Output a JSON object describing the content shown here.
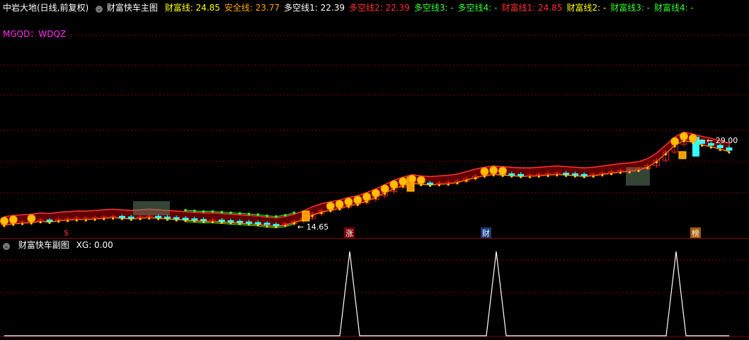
{
  "main_header": {
    "security_name": "中岩大地(日线,前复权)",
    "indicator_title": "财富快车主图",
    "items": [
      {
        "label": "财富线: 24.85",
        "color": "#ffff00"
      },
      {
        "label": "安全线: 23.77",
        "color": "#ffa500"
      },
      {
        "label": "多空线1: 22.39",
        "color": "#ffffff"
      },
      {
        "label": "多空线2: 22.39",
        "color": "#ff3030"
      },
      {
        "label": "多空线3: -",
        "color": "#33ff33"
      },
      {
        "label": "多空线4: -",
        "color": "#33ff33"
      },
      {
        "label": "财富线1: 24.85",
        "color": "#ff3030"
      },
      {
        "label": "财富线2: -",
        "color": "#ffff00"
      },
      {
        "label": "财富线3: -",
        "color": "#33ff33"
      },
      {
        "label": "财富线4: -",
        "color": "#33ff33"
      }
    ],
    "subtitle": "MGQD：WDQZ"
  },
  "annotations": {
    "high_label": "29.00",
    "low_label": "14.65",
    "signal_1": "$",
    "signal_2": "涨",
    "signal_3": "财",
    "signal_4": "榜"
  },
  "sub_header": {
    "indicator_title": "财富快车副图",
    "value_text": "XG: 0.00"
  },
  "icons": {
    "collapse": "chevron-down-icon"
  },
  "colors": {
    "background": "#000000",
    "grid": "#8b0000",
    "up_candle": "#ff2020",
    "down_candle": "#33ffff",
    "band_fill": "#b00000",
    "band_edge": "#ff3030",
    "green_line": "#33ff33",
    "coin": "#ffc000",
    "signal_line": "#ffffff"
  },
  "chart_data": [
    {
      "type": "candlestick",
      "title": "财富快车主图",
      "annotated_high": 29.0,
      "annotated_low": 14.65,
      "close_approx": [
        14.9,
        15.1,
        15.2,
        15.3,
        15.5,
        15.4,
        15.6,
        15.7,
        15.8,
        15.8,
        15.9,
        16.0,
        16.1,
        16.0,
        15.9,
        16.0,
        16.1,
        16.0,
        15.9,
        15.8,
        15.7,
        15.6,
        15.5,
        15.5,
        15.4,
        15.3,
        15.2,
        15.1,
        15.0,
        14.8,
        14.7,
        14.9,
        15.3,
        15.8,
        16.5,
        17.0,
        17.3,
        17.6,
        18.0,
        18.3,
        18.8,
        19.4,
        20.1,
        20.8,
        21.3,
        21.7,
        21.5,
        21.4,
        21.5,
        21.6,
        21.8,
        22.2,
        22.6,
        22.9,
        23.1,
        23.0,
        22.9,
        22.8,
        22.8,
        22.9,
        23.0,
        23.1,
        23.0,
        22.9,
        22.8,
        22.9,
        23.1,
        23.3,
        23.5,
        23.6,
        23.8,
        24.3,
        25.2,
        26.5,
        27.8,
        28.6,
        28.3,
        27.9,
        27.6,
        27.2,
        26.8
      ]
    },
    {
      "type": "line",
      "title": "财富快车副图",
      "series": [
        {
          "name": "XG",
          "values": [
            0,
            0,
            0,
            1,
            0,
            0,
            1,
            0,
            0,
            1,
            0
          ]
        }
      ],
      "signal_points": [
        "涨",
        "财",
        "榜"
      ]
    }
  ]
}
